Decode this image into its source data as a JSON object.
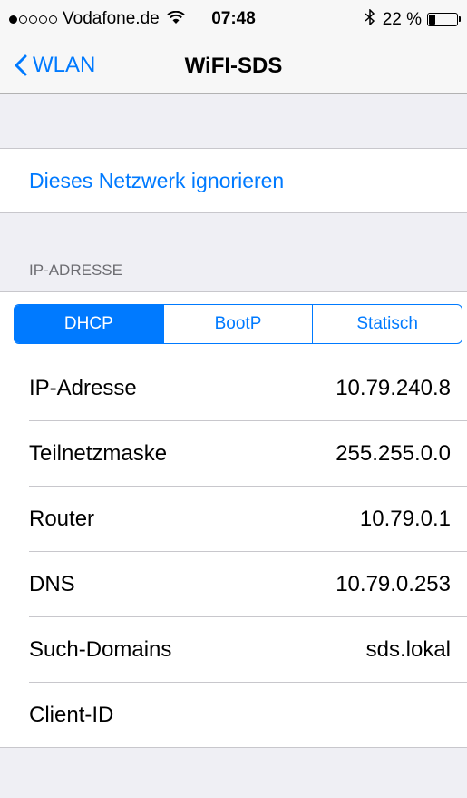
{
  "status_bar": {
    "carrier": "Vodafone.de",
    "time": "07:48",
    "battery": "22 %",
    "battery_level": 0.22
  },
  "nav": {
    "back_label": "WLAN",
    "title": "WiFI-SDS"
  },
  "actions": {
    "ignore_label": "Dieses Netzwerk ignorieren"
  },
  "ip_section": {
    "header": "IP-ADRESSE",
    "segments": [
      "DHCP",
      "BootP",
      "Statisch"
    ],
    "selected_segment": "DHCP",
    "rows": [
      {
        "label": "IP-Adresse",
        "value": "10.79.240.8"
      },
      {
        "label": "Teilnetzmaske",
        "value": "255.255.0.0"
      },
      {
        "label": "Router",
        "value": "10.79.0.1"
      },
      {
        "label": "DNS",
        "value": "10.79.0.253"
      },
      {
        "label": "Such-Domains",
        "value": "sds.lokal"
      },
      {
        "label": "Client-ID",
        "value": ""
      }
    ]
  },
  "colors": {
    "accent": "#007aff",
    "background": "#efeff4"
  }
}
